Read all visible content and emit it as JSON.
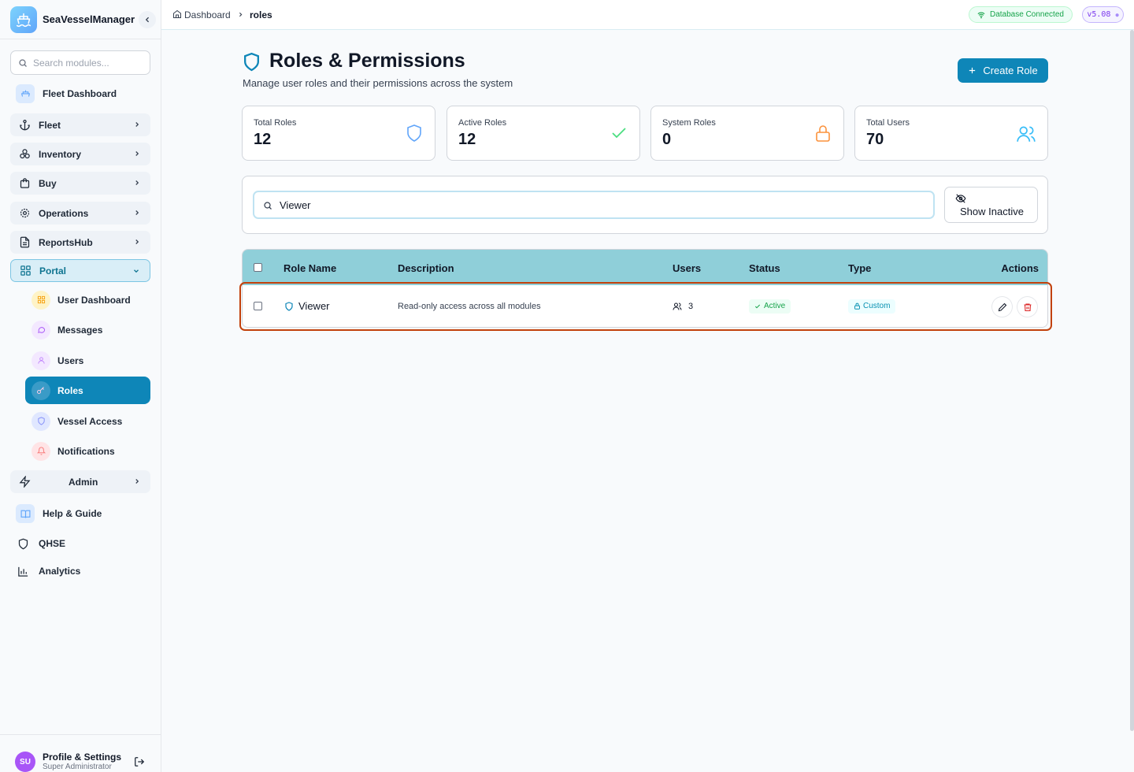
{
  "app": {
    "name": "SeaVesselManager"
  },
  "sidebar": {
    "search_placeholder": "Search modules...",
    "fleet_dashboard": "Fleet Dashboard",
    "groups": [
      {
        "label": "Fleet"
      },
      {
        "label": "Inventory"
      },
      {
        "label": "Buy"
      },
      {
        "label": "Operations"
      },
      {
        "label": "ReportsHub"
      },
      {
        "label": "Portal"
      }
    ],
    "portal_items": [
      {
        "label": "User Dashboard"
      },
      {
        "label": "Messages"
      },
      {
        "label": "Users"
      },
      {
        "label": "Roles"
      },
      {
        "label": "Vessel Access"
      },
      {
        "label": "Notifications"
      }
    ],
    "admin": "Admin",
    "help": "Help & Guide",
    "qhse": "QHSE",
    "analytics": "Analytics",
    "profile": {
      "initials": "SU",
      "name": "Profile & Settings",
      "role": "Super Administrator"
    }
  },
  "topbar": {
    "breadcrumb": [
      "Dashboard",
      "roles"
    ],
    "db_status": "Database Connected",
    "version": "v5.08"
  },
  "page": {
    "title": "Roles & Permissions",
    "subtitle": "Manage user roles and their permissions across the system",
    "create_button": "Create Role"
  },
  "stats": [
    {
      "label": "Total Roles",
      "value": "12"
    },
    {
      "label": "Active Roles",
      "value": "12"
    },
    {
      "label": "System Roles",
      "value": "0"
    },
    {
      "label": "Total Users",
      "value": "70"
    }
  ],
  "filter": {
    "search_value": "Viewer",
    "show_inactive": "Show Inactive"
  },
  "table": {
    "columns": [
      "Role Name",
      "Description",
      "Users",
      "Status",
      "Type",
      "Actions"
    ],
    "rows": [
      {
        "name": "Viewer",
        "description": "Read-only access across all modules",
        "users": "3",
        "status": "Active",
        "type": "Custom"
      }
    ]
  },
  "colors": {
    "accent": "#0e86b8",
    "table_header": "#8fcfd9",
    "highlight": "#c2410c"
  }
}
